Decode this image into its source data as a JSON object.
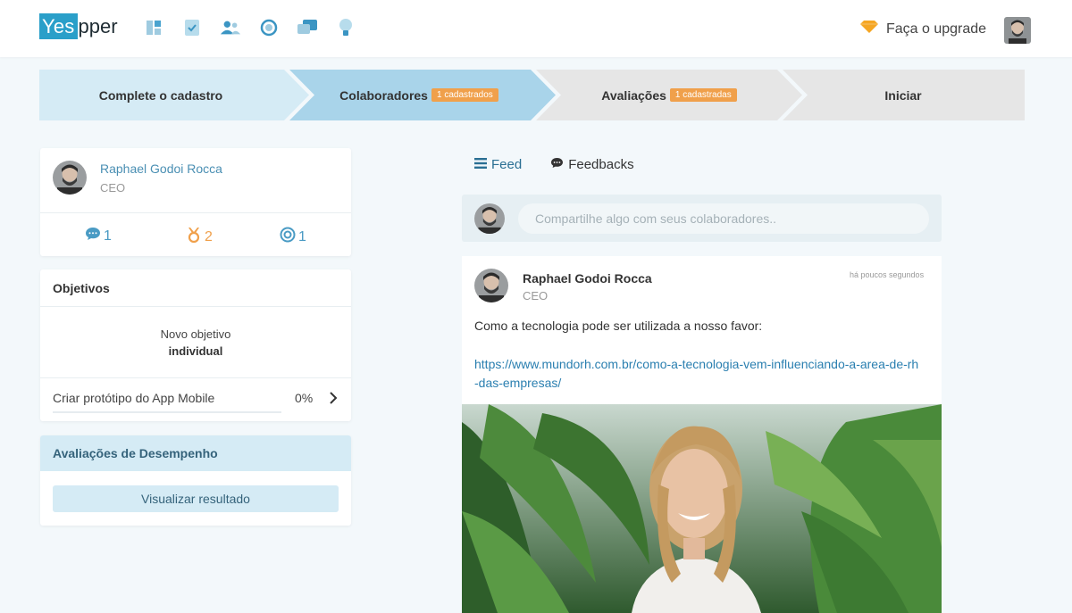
{
  "brand": {
    "logo_highlight": "Yes",
    "logo_rest": "pper",
    "accent": "#2a9fc9"
  },
  "nav": {
    "icons": [
      "dashboard-icon",
      "checklist-icon",
      "team-icon",
      "target-icon",
      "chat-icon",
      "lightbulb-icon"
    ]
  },
  "header": {
    "upgrade_label": "Faça o upgrade"
  },
  "steps": [
    {
      "label": "Complete o cadastro",
      "badge": ""
    },
    {
      "label": "Colaboradores",
      "badge": "1 cadastrados"
    },
    {
      "label": "Avaliações",
      "badge": "1 cadastradas"
    },
    {
      "label": "Iniciar",
      "badge": ""
    }
  ],
  "profile": {
    "name": "Raphael Godoi Rocca",
    "role": "CEO",
    "stats": {
      "feedbacks": "1",
      "medals": "2",
      "goals": "1"
    }
  },
  "objetivos": {
    "title": "Objetivos",
    "new_line1": "Novo objetivo",
    "new_line2": "individual",
    "item_label": "Criar protótipo do App Mobile",
    "item_pct": "0%",
    "item_progress": 0
  },
  "avaliacoes": {
    "title": "Avaliações de Desempenho",
    "button": "Visualizar resultado"
  },
  "tabs": {
    "feed": "Feed",
    "feedbacks": "Feedbacks"
  },
  "share": {
    "placeholder": "Compartilhe algo com seus colaboradores.."
  },
  "post": {
    "author": "Raphael Godoi Rocca",
    "role": "CEO",
    "time": "há poucos segundos",
    "text": "Como a tecnologia pode ser utilizada a nosso favor:",
    "link": "https://www.mundorh.com.br/como-a-tecnologia-vem-influenciando-a-area-de-rh-das-empresas/"
  }
}
